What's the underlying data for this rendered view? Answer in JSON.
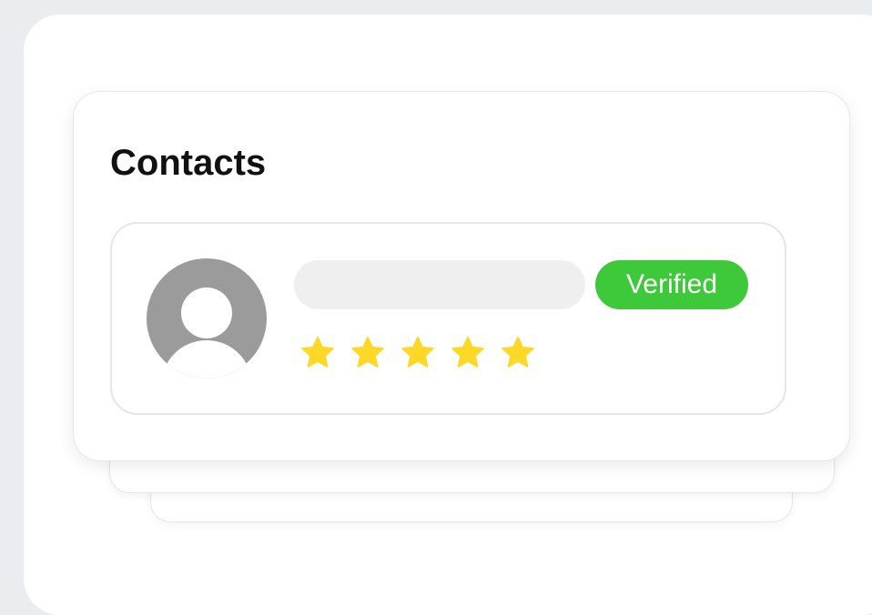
{
  "contacts_card": {
    "title": "Contacts",
    "contact": {
      "badge_label": "Verified",
      "rating": 5,
      "rating_max": 5,
      "avatar_icon": "user-avatar-icon",
      "star_icon": "star-icon"
    }
  },
  "colors": {
    "background": "#eaedef",
    "badge": "#3ec93a",
    "star": "#fed826",
    "avatar": "#9b9b9b",
    "placeholder": "#efefef"
  }
}
